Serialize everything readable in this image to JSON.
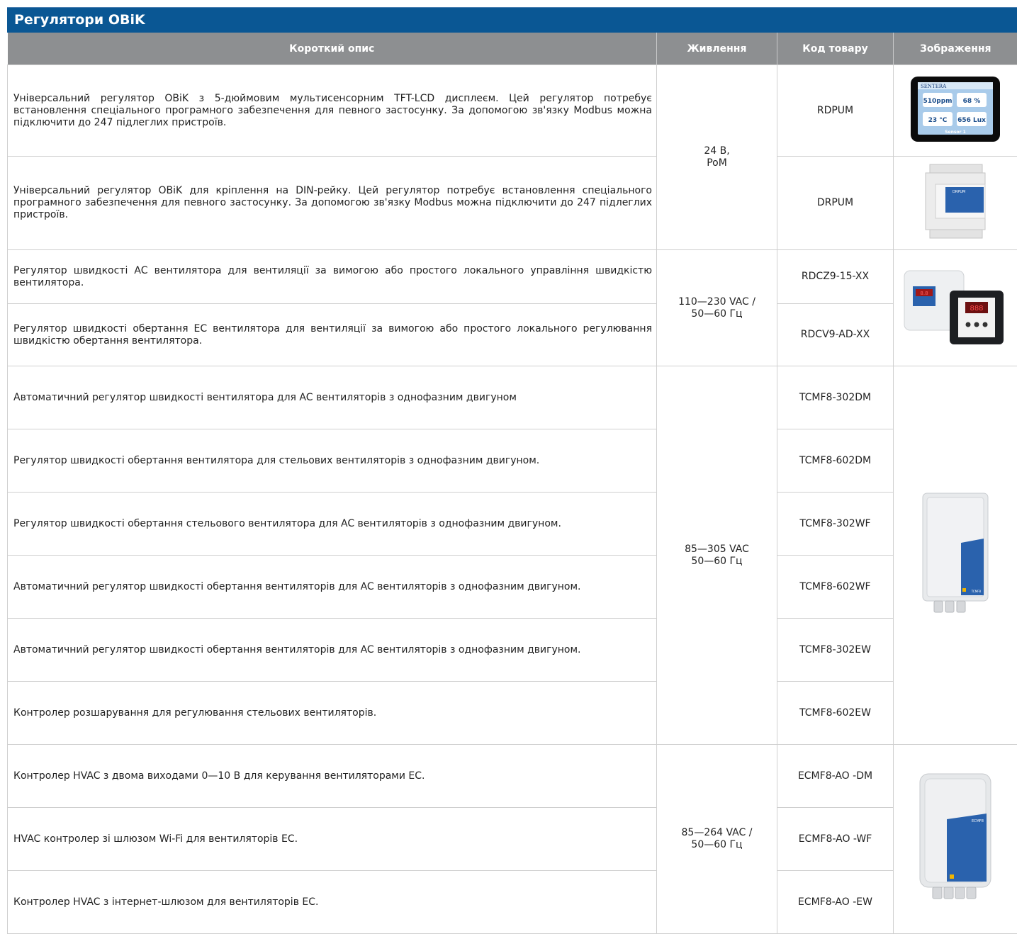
{
  "title": "Регулятори OBiK",
  "headers": {
    "desc": "Короткий опис",
    "power": "Живлення",
    "code": "Код товару",
    "image": "Зображення"
  },
  "rows": [
    {
      "desc": "Універсальний регулятор OBiK з 5-дюймовим мультисенсорним TFT-LCD дисплеєм. Цей регулятор потребує встановлення спеціального програмного забезпечення для певного застосунку. За допомогою зв'язку Modbus можна підключити до 247 підлеглих пристроїв.",
      "code": "RDPUM"
    },
    {
      "desc": "Універсальний регулятор OBiK для кріплення на DIN-рейку. Цей регулятор потребує встановлення спеціального програмного забезпечення для певного застосунку. За допомогою зв'язку Modbus можна підключити до 247 підлеглих пристроїв.",
      "code": "DRPUM"
    },
    {
      "desc": "Регулятор швидкості AC вентилятора для вентиляції за вимогою або простого локального управління швидкістю вентилятора.",
      "code": "RDCZ9-15-XX"
    },
    {
      "desc": "Регулятор швидкості обертання EC вентилятора для вентиляції за вимогою або простого локального регулювання швидкістю обертання вентилятора.",
      "code": "RDCV9-AD-XX"
    },
    {
      "desc": "Автоматичний регулятор швидкості вентилятора для AC вентиляторів з однофазним двигуном",
      "code": "TCMF8-302DM"
    },
    {
      "desc": "Регулятор швидкості обертання вентилятора для стельових вентиляторів з однофазним двигуном.",
      "code": "TCMF8-602DM"
    },
    {
      "desc": "Регулятор швидкості обертання стельового вентилятора для AC вентиляторів з однофазним двигуном.",
      "code": "TCMF8-302WF"
    },
    {
      "desc": "Автоматичний регулятор швидкості обертання вентиляторів для AC вентиляторів з однофазним двигуном.",
      "code": "TCMF8-602WF"
    },
    {
      "desc": "Автоматичний регулятор швидкості обертання вентиляторів для AC вентиляторів з однофазним двигуном.",
      "code": "TCMF8-302EW"
    },
    {
      "desc": "Контролер розшарування для регулювання стельових вентиляторів.",
      "code": "TCMF8-602EW"
    },
    {
      "desc": "Контролер HVAC з двома виходами 0—10 В для керування вентиляторами EC.",
      "code": "ECMF8-AO -DM"
    },
    {
      "desc": "HVAC контролер зі шлюзом Wi-Fi для вентиляторів EC.",
      "code": "ECMF8-AO -WF"
    },
    {
      "desc": "Контролер HVAC з інтернет-шлюзом для вентиляторів EC.",
      "code": "ECMF8-AO -EW"
    }
  ],
  "power": [
    {
      "line1": "24 В,",
      "line2": "PoM"
    },
    {
      "line1": "110—230 VAC /",
      "line2": "50—60 Гц"
    },
    {
      "line1": "85—305 VAC",
      "line2": "50—60 Гц"
    },
    {
      "line1": "85—264 VAC /",
      "line2": "50—60 Гц"
    }
  ],
  "images": {
    "rdpum_logo": "SENTERA",
    "rdpum_tiles": [
      "510ppm",
      "68 %",
      "23 °C",
      "656 Lux"
    ],
    "rdpum_footer": "Sensor 1",
    "drpum_label": "DRPUM",
    "rdc_display_1": "8.8",
    "rdc_display_2": "888",
    "tcmf_label": "TCMF8",
    "ecmf_label": "ECMF8"
  },
  "colors": {
    "title_bar": "#0a5794",
    "header_bar": "#8d8f91",
    "device_blue": "#2a62ad"
  }
}
